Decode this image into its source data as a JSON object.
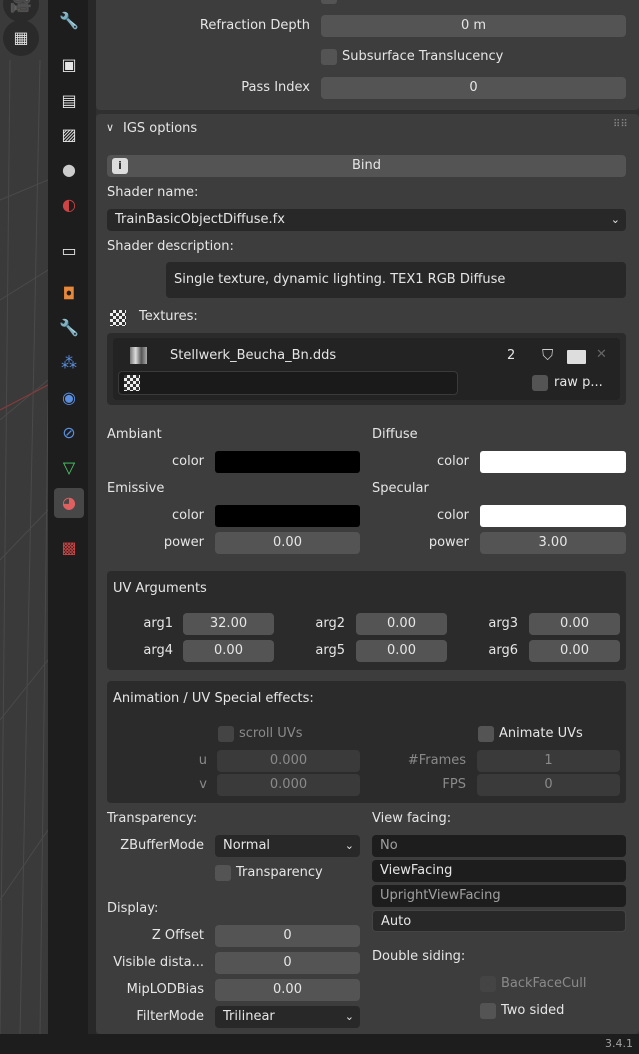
{
  "top": {
    "refraction_depth_label": "Refraction Depth",
    "refraction_depth_value": "0 m",
    "subsurface_label": "Subsurface Translucency",
    "pass_index_label": "Pass Index",
    "pass_index_value": "0"
  },
  "igs": {
    "title": "IGS options",
    "bind_label": "Bind",
    "shader_name_label": "Shader name:",
    "shader_name_value": "TrainBasicObjectDiffuse.fx",
    "shader_desc_label": "Shader description:",
    "shader_desc_value": "Single texture, dynamic lighting. TEX1 RGB Diffuse",
    "textures_label": "Textures:",
    "texture": {
      "name": "Stellwerk_Beucha_Bn.dds",
      "count": "2",
      "raw_label": "raw p..."
    }
  },
  "material": {
    "ambiant": "Ambiant",
    "diffuse": "Diffuse",
    "emissive": "Emissive",
    "specular": "Specular",
    "color": "color",
    "power": "power",
    "emissive_power": "0.00",
    "specular_power": "3.00",
    "ambiant_color": "#000000",
    "diffuse_color": "#ffffff",
    "emissive_color": "#000000",
    "specular_color": "#ffffff"
  },
  "uv": {
    "title": "UV Arguments",
    "args": [
      {
        "label": "arg1",
        "value": "32.00"
      },
      {
        "label": "arg2",
        "value": "0.00"
      },
      {
        "label": "arg3",
        "value": "0.00"
      },
      {
        "label": "arg4",
        "value": "0.00"
      },
      {
        "label": "arg5",
        "value": "0.00"
      },
      {
        "label": "arg6",
        "value": "0.00"
      }
    ]
  },
  "anim": {
    "title": "Animation / UV Special effects:",
    "scroll_label": "scroll UVs",
    "animate_label": "Animate UVs",
    "u_label": "u",
    "u_value": "0.000",
    "v_label": "v",
    "v_value": "0.000",
    "frames_label": "#Frames",
    "frames_value": "1",
    "fps_label": "FPS",
    "fps_value": "0"
  },
  "transparency": {
    "title": "Transparency:",
    "zbuffer_label": "ZBufferMode",
    "zbuffer_value": "Normal",
    "transparency_label": "Transparency"
  },
  "view_facing": {
    "title": "View facing:",
    "options": [
      "No",
      "ViewFacing",
      "UprightViewFacing",
      "Auto"
    ],
    "selected": "Auto"
  },
  "display": {
    "title": "Display:",
    "zoffset_label": "Z Offset",
    "zoffset_value": "0",
    "visible_label": "Visible dista...",
    "visible_value": "0",
    "miplod_label": "MipLODBias",
    "miplod_value": "0.00",
    "filter_label": "FilterMode",
    "filter_value": "Trilinear"
  },
  "double_siding": {
    "title": "Double siding:",
    "backface_label": "BackFaceCull",
    "twosided_label": "Two sided"
  },
  "status": {
    "version": "3.4.1"
  }
}
